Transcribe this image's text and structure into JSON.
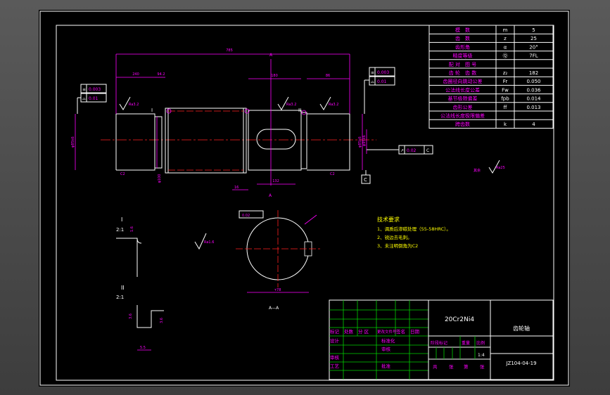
{
  "params": [
    {
      "name": "模　数",
      "sym": "m",
      "val": "5"
    },
    {
      "name": "齿　数",
      "sym": "z",
      "val": "25"
    },
    {
      "name": "齿形角",
      "sym": "α",
      "val": "20°"
    },
    {
      "name": "精度等级",
      "sym": "Ⓠ",
      "val": "7FL"
    },
    {
      "name": "配 对　图 号",
      "sym": "",
      "val": ""
    },
    {
      "name": "齿 轮　齿 数",
      "sym": "z₂",
      "val": "182"
    },
    {
      "name": "齿圈径向跳动公差",
      "sym": "Fr",
      "val": "0.050"
    },
    {
      "name": "公法线长度公差",
      "sym": "Fw",
      "val": "0.036"
    },
    {
      "name": "基节极限偏差",
      "sym": "fpb",
      "val": "0.014"
    },
    {
      "name": "齿形公差",
      "sym": "ff",
      "val": "0.013"
    },
    {
      "name": "公法线长度极限偏差",
      "sym": "",
      "val": ""
    },
    {
      "name": "跨齿数",
      "sym": "k",
      "val": "4"
    }
  ],
  "tech": {
    "title": "技术要求",
    "items": [
      "1、调质后渗碳处理（55-58HRC）。",
      "2、锐边去毛刺。",
      "3、未注明倒角为C2"
    ]
  },
  "title_block": {
    "material": "20Cr2Ni4",
    "part_name": "齿轮轴",
    "drawing_no": "JZ104-04-19",
    "scale": "1:4",
    "labels": {
      "mark": "标记",
      "count": "处数",
      "zone": "分 区",
      "doc": "更改文件号",
      "sign": "签名",
      "date": "日期",
      "design": "设计",
      "std": "标准化",
      "review": "审核",
      "tech": "工艺",
      "approve": "批准",
      "stage": "阶段标记",
      "weight": "重量",
      "scale": "比例",
      "total": "共",
      "sheets": "张",
      "sheet_no": "第",
      "sheet_unit": "张"
    }
  },
  "dims": {
    "overall": "785",
    "d240": "240",
    "d42": "94.2",
    "d180": "180",
    "d86": "86",
    "d132": "132",
    "d16": "16",
    "dia_left": "φ85k6",
    "dia_mid": "φ100",
    "dia_right": "φ85k6",
    "dia_gear": "φ135",
    "dia_shaft": "φ95k6"
  },
  "tolerances": {
    "left": [
      {
        "sym": "≡",
        "val": "0.003"
      },
      {
        "sym": "⌓",
        "val": "0.01"
      }
    ],
    "right": [
      {
        "sym": "≡",
        "val": "0.003"
      },
      {
        "sym": "⌓",
        "val": "0.01"
      }
    ],
    "runout": {
      "sym": "↗",
      "val": "0.02",
      "ref": "C"
    },
    "section": {
      "sym": "≡",
      "val": "0.02",
      "ref": "C"
    }
  },
  "roughness": [
    "Ra3.2",
    "Ra3.2",
    "Ra3.2",
    "Ra1.6",
    "Ra3.2",
    "Ra25"
  ],
  "roughness_other": "其余",
  "datum": "C",
  "section_label": "A—A",
  "section_dim": "τ78",
  "section_mark": "A",
  "detail_I": {
    "label": "I",
    "scale": "2:1",
    "dims": [
      "1.6"
    ]
  },
  "detail_II": {
    "label": "II",
    "scale": "2:1",
    "dims": [
      "3.6",
      "3.6",
      "5.5"
    ]
  }
}
